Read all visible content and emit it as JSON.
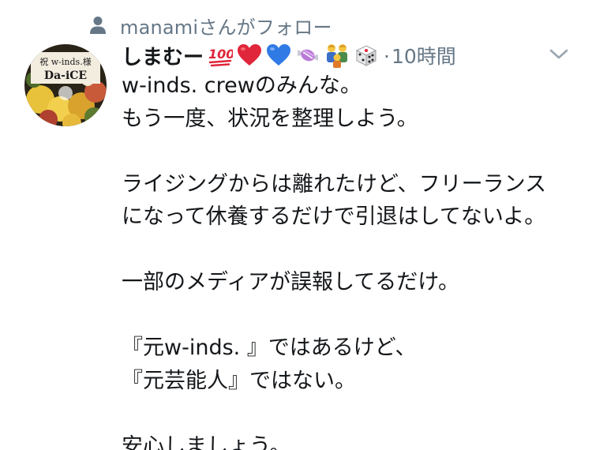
{
  "social_context": {
    "icon": "person-icon",
    "text": "manamiさんがフォロー"
  },
  "author": {
    "display_name": "しまむー",
    "avatar_sign_line1": "祝 w-inds.様",
    "avatar_sign_line2": "Da-iCE",
    "emojis": [
      "hundred-points-icon",
      "red-heart-icon",
      "blue-heart-icon",
      "candy-icon",
      "family-icon",
      "dice-icon"
    ]
  },
  "meta": {
    "separator": "·",
    "time": "10時間"
  },
  "colors": {
    "text": "#14171a",
    "secondary": "#657786",
    "red_heart": "#e0263b",
    "blue_heart": "#2f7ae5"
  },
  "tweet": {
    "lines": [
      "w-inds. crewのみんな。",
      "もう一度、状況を整理しよう。",
      "",
      "ライジングからは離れたけど、フリーランス",
      "になって休養するだけで引退はしてないよ。",
      "",
      "一部のメディアが誤報してるだけ。",
      "",
      "『元w-inds. 』ではあるけど、",
      "『元芸能人』ではない。",
      "",
      "安心しましょう。"
    ]
  }
}
